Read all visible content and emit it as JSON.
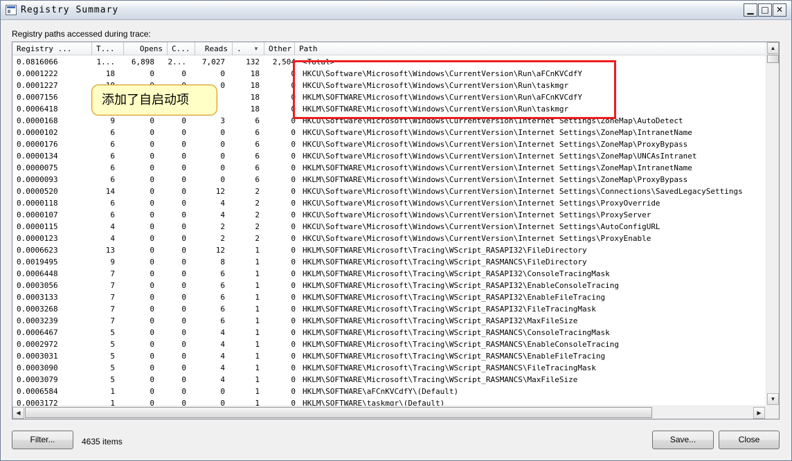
{
  "window": {
    "title": "Registry Summary",
    "minimize_glyph": "▁",
    "restore_glyph": "□",
    "close_glyph": "✕"
  },
  "label": "Registry paths accessed during trace:",
  "columns": [
    "Registry ...",
    "T...",
    "Opens",
    "C...",
    "Reads",
    ".",
    "Other",
    "Path"
  ],
  "rows": [
    [
      "0.0816066",
      "1...",
      "6,898",
      "2...",
      "7,027",
      "132",
      "2,504",
      "<Total>"
    ],
    [
      "0.0001222",
      "18",
      "0",
      "0",
      "0",
      "18",
      "0",
      "HKCU\\Software\\Microsoft\\Windows\\CurrentVersion\\Run\\aFCnKVCdfY"
    ],
    [
      "0.0001227",
      "18",
      "0",
      "0",
      "0",
      "18",
      "0",
      "HKCU\\Software\\Microsoft\\Windows\\CurrentVersion\\Run\\taskmgr"
    ],
    [
      "0.0007156",
      "",
      "",
      "",
      "",
      "18",
      "0",
      "HKLM\\SOFTWARE\\Microsoft\\Windows\\CurrentVersion\\Run\\aFCnKVCdfY"
    ],
    [
      "0.0006418",
      "",
      "",
      "",
      "",
      "18",
      "0",
      "HKLM\\SOFTWARE\\Microsoft\\Windows\\CurrentVersion\\Run\\taskmgr"
    ],
    [
      "0.0000168",
      "9",
      "0",
      "0",
      "3",
      "6",
      "0",
      "HKCU\\Software\\Microsoft\\Windows\\CurrentVersion\\Internet Settings\\ZoneMap\\AutoDetect"
    ],
    [
      "0.0000102",
      "6",
      "0",
      "0",
      "0",
      "6",
      "0",
      "HKCU\\Software\\Microsoft\\Windows\\CurrentVersion\\Internet Settings\\ZoneMap\\IntranetName"
    ],
    [
      "0.0000176",
      "6",
      "0",
      "0",
      "0",
      "6",
      "0",
      "HKCU\\Software\\Microsoft\\Windows\\CurrentVersion\\Internet Settings\\ZoneMap\\ProxyBypass"
    ],
    [
      "0.0000134",
      "6",
      "0",
      "0",
      "0",
      "6",
      "0",
      "HKCU\\Software\\Microsoft\\Windows\\CurrentVersion\\Internet Settings\\ZoneMap\\UNCAsIntranet"
    ],
    [
      "0.0000075",
      "6",
      "0",
      "0",
      "0",
      "6",
      "0",
      "HKLM\\SOFTWARE\\Microsoft\\Windows\\CurrentVersion\\Internet Settings\\ZoneMap\\IntranetName"
    ],
    [
      "0.0000093",
      "6",
      "0",
      "0",
      "0",
      "6",
      "0",
      "HKLM\\SOFTWARE\\Microsoft\\Windows\\CurrentVersion\\Internet Settings\\ZoneMap\\ProxyBypass"
    ],
    [
      "0.0000520",
      "14",
      "0",
      "0",
      "12",
      "2",
      "0",
      "HKCU\\Software\\Microsoft\\Windows\\CurrentVersion\\Internet Settings\\Connections\\SavedLegacySettings"
    ],
    [
      "0.0000118",
      "6",
      "0",
      "0",
      "4",
      "2",
      "0",
      "HKCU\\Software\\Microsoft\\Windows\\CurrentVersion\\Internet Settings\\ProxyOverride"
    ],
    [
      "0.0000107",
      "6",
      "0",
      "0",
      "4",
      "2",
      "0",
      "HKCU\\Software\\Microsoft\\Windows\\CurrentVersion\\Internet Settings\\ProxyServer"
    ],
    [
      "0.0000115",
      "4",
      "0",
      "0",
      "2",
      "2",
      "0",
      "HKCU\\Software\\Microsoft\\Windows\\CurrentVersion\\Internet Settings\\AutoConfigURL"
    ],
    [
      "0.0000123",
      "4",
      "0",
      "0",
      "2",
      "2",
      "0",
      "HKCU\\Software\\Microsoft\\Windows\\CurrentVersion\\Internet Settings\\ProxyEnable"
    ],
    [
      "0.0006623",
      "13",
      "0",
      "0",
      "12",
      "1",
      "0",
      "HKLM\\SOFTWARE\\Microsoft\\Tracing\\WScript_RASAPI32\\FileDirectory"
    ],
    [
      "0.0019495",
      "9",
      "0",
      "0",
      "8",
      "1",
      "0",
      "HKLM\\SOFTWARE\\Microsoft\\Tracing\\WScript_RASMANCS\\FileDirectory"
    ],
    [
      "0.0006448",
      "7",
      "0",
      "0",
      "6",
      "1",
      "0",
      "HKLM\\SOFTWARE\\Microsoft\\Tracing\\WScript_RASAPI32\\ConsoleTracingMask"
    ],
    [
      "0.0003056",
      "7",
      "0",
      "0",
      "6",
      "1",
      "0",
      "HKLM\\SOFTWARE\\Microsoft\\Tracing\\WScript_RASAPI32\\EnableConsoleTracing"
    ],
    [
      "0.0003133",
      "7",
      "0",
      "0",
      "6",
      "1",
      "0",
      "HKLM\\SOFTWARE\\Microsoft\\Tracing\\WScript_RASAPI32\\EnableFileTracing"
    ],
    [
      "0.0003268",
      "7",
      "0",
      "0",
      "6",
      "1",
      "0",
      "HKLM\\SOFTWARE\\Microsoft\\Tracing\\WScript_RASAPI32\\FileTracingMask"
    ],
    [
      "0.0003239",
      "7",
      "0",
      "0",
      "6",
      "1",
      "0",
      "HKLM\\SOFTWARE\\Microsoft\\Tracing\\WScript_RASAPI32\\MaxFileSize"
    ],
    [
      "0.0006467",
      "5",
      "0",
      "0",
      "4",
      "1",
      "0",
      "HKLM\\SOFTWARE\\Microsoft\\Tracing\\WScript_RASMANCS\\ConsoleTracingMask"
    ],
    [
      "0.0002972",
      "5",
      "0",
      "0",
      "4",
      "1",
      "0",
      "HKLM\\SOFTWARE\\Microsoft\\Tracing\\WScript_RASMANCS\\EnableConsoleTracing"
    ],
    [
      "0.0003031",
      "5",
      "0",
      "0",
      "4",
      "1",
      "0",
      "HKLM\\SOFTWARE\\Microsoft\\Tracing\\WScript_RASMANCS\\EnableFileTracing"
    ],
    [
      "0.0003090",
      "5",
      "0",
      "0",
      "4",
      "1",
      "0",
      "HKLM\\SOFTWARE\\Microsoft\\Tracing\\WScript_RASMANCS\\FileTracingMask"
    ],
    [
      "0.0003079",
      "5",
      "0",
      "0",
      "4",
      "1",
      "0",
      "HKLM\\SOFTWARE\\Microsoft\\Tracing\\WScript_RASMANCS\\MaxFileSize"
    ],
    [
      "0.0006584",
      "1",
      "0",
      "0",
      "0",
      "1",
      "0",
      "HKLM\\SOFTWARE\\aFCnKVCdfY\\(Default)"
    ],
    [
      "0.0003172",
      "1",
      "0",
      "0",
      "0",
      "1",
      "0",
      "HKLM\\SOFTWARE\\taskmgr\\(Default)"
    ]
  ],
  "callout": "添加了自启动项",
  "buttons": {
    "filter": "Filter...",
    "save": "Save...",
    "close": "Close"
  },
  "item_count": "4635 items",
  "scroll": {
    "up": "▲",
    "down": "▼",
    "left": "◀",
    "right": "▶",
    "sort": "▼"
  },
  "colors": {
    "highlight": "#ee1c1c",
    "callout_bg": "#ffffc6"
  }
}
